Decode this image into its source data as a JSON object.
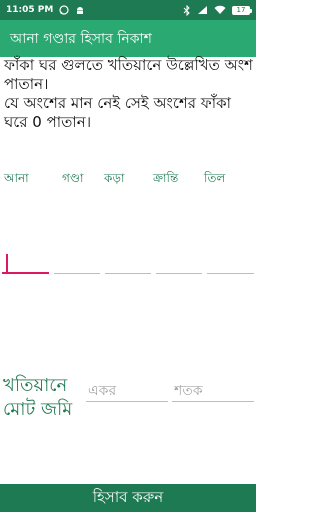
{
  "status_bar": {
    "time": "11:05 PM",
    "battery_level": "17",
    "icons": [
      "whatsapp-icon",
      "android-icon",
      "bluetooth-icon",
      "signal-icon",
      "wifi-icon"
    ]
  },
  "app_bar": {
    "title": "আনা গণ্ডার হিসাব নিকাশ"
  },
  "instructions": {
    "line1": "ফাঁকা ঘর গুলতে খতিয়ানে উল্লেখিত অংশ পাতান।",
    "line2": "যে অংশের মান নেই সেই অংশের ফাঁকা ঘরে 0 পাতান।"
  },
  "units": [
    "আনা",
    "গণ্ডা",
    "কড়া",
    "ক্রান্তি",
    "তিল"
  ],
  "fields": {
    "ana": "",
    "ganda": "",
    "kora": "",
    "kranti": "",
    "til": ""
  },
  "total": {
    "label": "খতিয়ানে মোট জমি",
    "acre_placeholder": "একর",
    "shatak_placeholder": "শতক"
  },
  "action": {
    "calculate_label": "হিসাব করুন"
  },
  "colors": {
    "primary": "#2aa972",
    "primary_dark": "#1d7a52",
    "accent": "#d81b60"
  }
}
